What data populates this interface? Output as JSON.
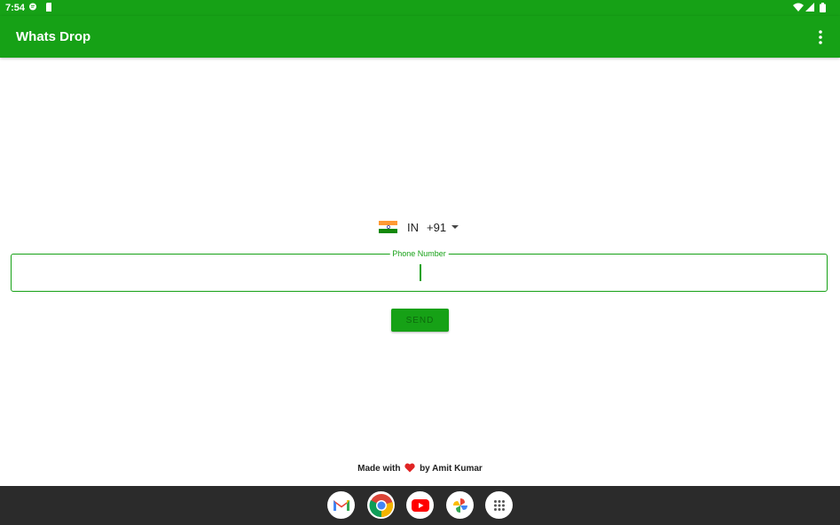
{
  "status_bar": {
    "time": "7:54"
  },
  "app_bar": {
    "title": "Whats Drop"
  },
  "country_picker": {
    "country": "IN",
    "dial_code": "+91"
  },
  "phone_field": {
    "label": "Phone Number",
    "value": ""
  },
  "send_button": {
    "label": "SEND"
  },
  "footer": {
    "prefix": "Made with",
    "suffix": "by Amit Kumar"
  },
  "dock": {
    "apps": [
      "gmail-icon",
      "chrome-icon",
      "youtube-icon",
      "photos-icon",
      "app-drawer-icon"
    ]
  },
  "colors": {
    "primary": "#16a116",
    "heart": "#e02424",
    "dock_background": "#2b2b2b"
  }
}
